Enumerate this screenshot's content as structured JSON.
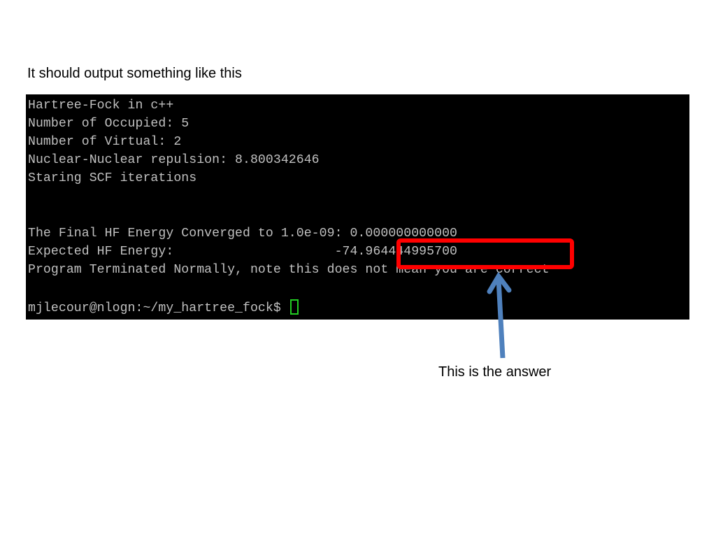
{
  "slide": {
    "caption": "It should output something like this",
    "annotation_label": "This is the answer"
  },
  "terminal": {
    "lines": [
      "Hartree-Fock in c++",
      "Number of Occupied: 5",
      "Number of Virtual: 2",
      "Nuclear-Nuclear repulsion: 8.800342646",
      "Staring SCF iterations",
      "",
      "",
      "The Final HF Energy Converged to 1.0e-09: 0.000000000000",
      "Expected HF Energy:                     -74.964444995700",
      "Program Terminated Normally, note this does not mean you are correct",
      ""
    ],
    "prompt": "mjlecour@nlogn:~/my_hartree_fock$ ",
    "highlighted_value": "-74.964444995700",
    "colors": {
      "background": "#000000",
      "text": "#c0c0c0",
      "cursor": "#22cc22",
      "highlight_box": "#ff0000",
      "arrow": "#4f81bd"
    }
  }
}
